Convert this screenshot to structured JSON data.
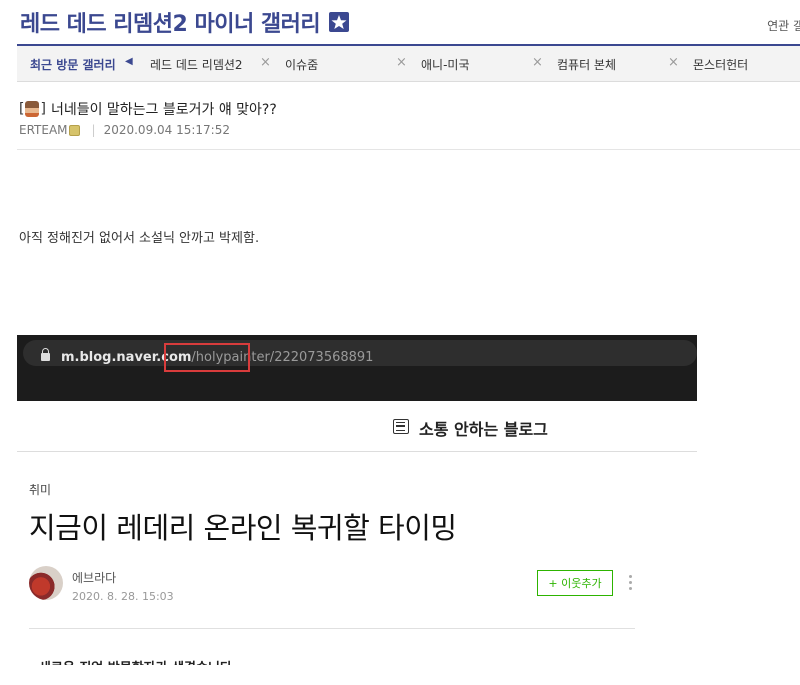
{
  "gallery": {
    "title": "레드 데드 리뎀션2 마이너 갤러리",
    "related": "연관 갤"
  },
  "recent_bar": {
    "label": "최근 방문 갤러리",
    "arrow": "◀",
    "items": [
      {
        "label": "레드 데드 리뎀션2",
        "close": "×"
      },
      {
        "label": "이슈줌",
        "close": "×"
      },
      {
        "label": "애니-미국",
        "close": "×"
      },
      {
        "label": "컴퓨터 본체",
        "close": "×"
      },
      {
        "label": "몬스터헌터"
      }
    ]
  },
  "post": {
    "title": "너네들이 말하는그 블로거가 얘 맞아??",
    "head_open": "[",
    "head_close": "]",
    "author": "ERTEAM",
    "sep": "|",
    "datetime": "2020.09.04 15:17:52",
    "body": "아직 정해진거 없어서 소설닉 안까고 박제함."
  },
  "embed": {
    "url_host": "m.blog.naver.com",
    "url_path": "/holypainter/222073568891",
    "blog_name": "소통 안하는 블로그",
    "category": "취미",
    "article_title": "지금이 레데리 온라인 복귀할 타이밍",
    "author_name": "에브라다",
    "date": "2020. 8. 28. 15:03",
    "neighbor_button": "+ 이웃추가",
    "body_line": "- 새로운 직업 박물학자가 생겼습니다."
  },
  "colors": {
    "accent": "#3b4890",
    "highlight_box": "#d83c3c",
    "neighbor_green": "#2db400"
  }
}
